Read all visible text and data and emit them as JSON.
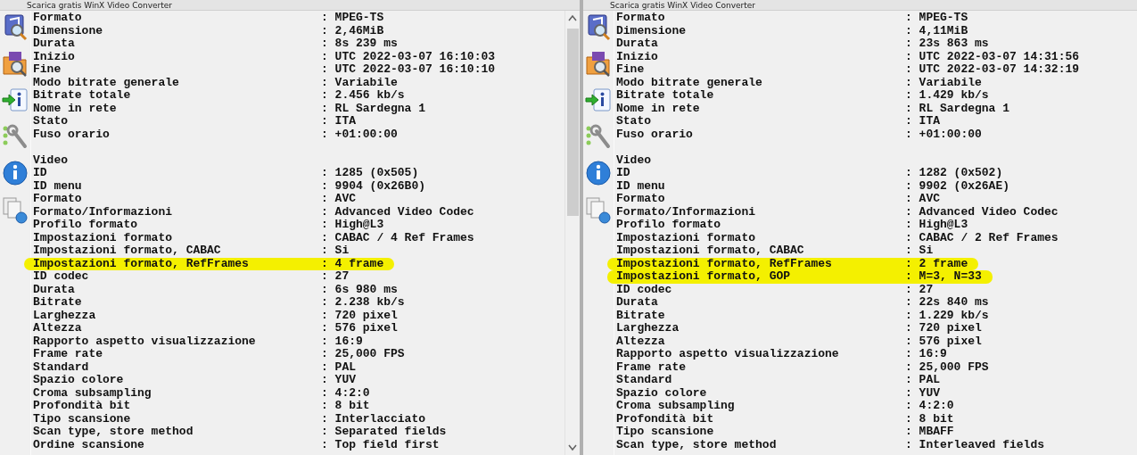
{
  "panels": [
    {
      "title": "Scarica gratis WinX Video Converter",
      "has_scrollbar": true,
      "sections": [
        {
          "rows": [
            {
              "label": "Formato",
              "value": ": MPEG-TS",
              "highlighted": false
            },
            {
              "label": "Dimensione",
              "value": ": 2,46MiB",
              "highlighted": false
            },
            {
              "label": "Durata",
              "value": ": 8s 239 ms",
              "highlighted": false
            },
            {
              "label": "Inizio",
              "value": ": UTC 2022-03-07 16:10:03",
              "highlighted": false
            },
            {
              "label": "Fine",
              "value": ": UTC 2022-03-07 16:10:10",
              "highlighted": false
            },
            {
              "label": "Modo bitrate generale",
              "value": ": Variabile",
              "highlighted": false
            },
            {
              "label": "Bitrate totale",
              "value": ": 2.456 kb/s",
              "highlighted": false
            },
            {
              "label": "Nome in rete",
              "value": ": RL Sardegna 1",
              "highlighted": false
            },
            {
              "label": "Stato",
              "value": ": ITA",
              "highlighted": false
            },
            {
              "label": "Fuso orario",
              "value": ": +01:00:00",
              "highlighted": false
            }
          ]
        },
        {
          "heading": "Video",
          "rows": [
            {
              "label": "ID",
              "value": ": 1285 (0x505)",
              "highlighted": false
            },
            {
              "label": "ID menu",
              "value": ": 9904 (0x26B0)",
              "highlighted": false
            },
            {
              "label": "Formato",
              "value": ": AVC",
              "highlighted": false
            },
            {
              "label": "Formato/Informazioni",
              "value": ": Advanced Video Codec",
              "highlighted": false
            },
            {
              "label": "Profilo formato",
              "value": ": High@L3",
              "highlighted": false
            },
            {
              "label": "Impostazioni formato",
              "value": ": CABAC / 4 Ref Frames",
              "highlighted": false
            },
            {
              "label": "Impostazioni formato, CABAC",
              "value": ": Si",
              "highlighted": false
            },
            {
              "label": "Impostazioni formato, RefFrames",
              "value": ": 4 frame",
              "highlighted": true
            },
            {
              "label": "ID codec",
              "value": ": 27",
              "highlighted": false
            },
            {
              "label": "Durata",
              "value": ": 6s 980 ms",
              "highlighted": false
            },
            {
              "label": "Bitrate",
              "value": ": 2.238 kb/s",
              "highlighted": false
            },
            {
              "label": "Larghezza",
              "value": ": 720 pixel",
              "highlighted": false
            },
            {
              "label": "Altezza",
              "value": ": 576 pixel",
              "highlighted": false
            },
            {
              "label": "Rapporto aspetto visualizzazione",
              "value": ": 16:9",
              "highlighted": false
            },
            {
              "label": "Frame rate",
              "value": ": 25,000 FPS",
              "highlighted": false
            },
            {
              "label": "Standard",
              "value": ": PAL",
              "highlighted": false
            },
            {
              "label": "Spazio colore",
              "value": ": YUV",
              "highlighted": false
            },
            {
              "label": "Croma subsampling",
              "value": ": 4:2:0",
              "highlighted": false
            },
            {
              "label": "Profondità bit",
              "value": ": 8 bit",
              "highlighted": false
            },
            {
              "label": "Tipo scansione",
              "value": ": Interlacciato",
              "highlighted": false
            },
            {
              "label": "Scan type, store method",
              "value": ": Separated fields",
              "highlighted": false
            },
            {
              "label": "Ordine scansione",
              "value": ": Top field first",
              "highlighted": false
            }
          ]
        }
      ]
    },
    {
      "title": "Scarica gratis WinX Video Converter",
      "has_scrollbar": false,
      "sections": [
        {
          "rows": [
            {
              "label": "Formato",
              "value": ": MPEG-TS",
              "highlighted": false
            },
            {
              "label": "Dimensione",
              "value": ": 4,11MiB",
              "highlighted": false
            },
            {
              "label": "Durata",
              "value": ": 23s 863 ms",
              "highlighted": false
            },
            {
              "label": "Inizio",
              "value": ": UTC 2022-03-07 14:31:56",
              "highlighted": false
            },
            {
              "label": "Fine",
              "value": ": UTC 2022-03-07 14:32:19",
              "highlighted": false
            },
            {
              "label": "Modo bitrate generale",
              "value": ": Variabile",
              "highlighted": false
            },
            {
              "label": "Bitrate totale",
              "value": ": 1.429 kb/s",
              "highlighted": false
            },
            {
              "label": "Nome in rete",
              "value": ": RL Sardegna 1",
              "highlighted": false
            },
            {
              "label": "Stato",
              "value": ": ITA",
              "highlighted": false
            },
            {
              "label": "Fuso orario",
              "value": ": +01:00:00",
              "highlighted": false
            }
          ]
        },
        {
          "heading": "Video",
          "rows": [
            {
              "label": "ID",
              "value": ": 1282 (0x502)",
              "highlighted": false
            },
            {
              "label": "ID menu",
              "value": ": 9902 (0x26AE)",
              "highlighted": false
            },
            {
              "label": "Formato",
              "value": ": AVC",
              "highlighted": false
            },
            {
              "label": "Formato/Informazioni",
              "value": ": Advanced Video Codec",
              "highlighted": false
            },
            {
              "label": "Profilo formato",
              "value": ": High@L3",
              "highlighted": false
            },
            {
              "label": "Impostazioni formato",
              "value": ": CABAC / 2 Ref Frames",
              "highlighted": false
            },
            {
              "label": "Impostazioni formato, CABAC",
              "value": ": Si",
              "highlighted": false
            },
            {
              "label": "Impostazioni formato, RefFrames",
              "value": ": 2 frame",
              "highlighted": true
            },
            {
              "label": "Impostazioni formato, GOP",
              "value": ": M=3, N=33",
              "highlighted": true
            },
            {
              "label": "ID codec",
              "value": ": 27",
              "highlighted": false
            },
            {
              "label": "Durata",
              "value": ": 22s 840 ms",
              "highlighted": false
            },
            {
              "label": "Bitrate",
              "value": ": 1.229 kb/s",
              "highlighted": false
            },
            {
              "label": "Larghezza",
              "value": ": 720 pixel",
              "highlighted": false
            },
            {
              "label": "Altezza",
              "value": ": 576 pixel",
              "highlighted": false
            },
            {
              "label": "Rapporto aspetto visualizzazione",
              "value": ": 16:9",
              "highlighted": false
            },
            {
              "label": "Frame rate",
              "value": ": 25,000 FPS",
              "highlighted": false
            },
            {
              "label": "Standard",
              "value": ": PAL",
              "highlighted": false
            },
            {
              "label": "Spazio colore",
              "value": ": YUV",
              "highlighted": false
            },
            {
              "label": "Croma subsampling",
              "value": ": 4:2:0",
              "highlighted": false
            },
            {
              "label": "Profondità bit",
              "value": ": 8 bit",
              "highlighted": false
            },
            {
              "label": "Tipo scansione",
              "value": ": MBAFF",
              "highlighted": false
            },
            {
              "label": "Scan type, store method",
              "value": ": Interleaved fields",
              "highlighted": false
            }
          ]
        }
      ]
    }
  ]
}
